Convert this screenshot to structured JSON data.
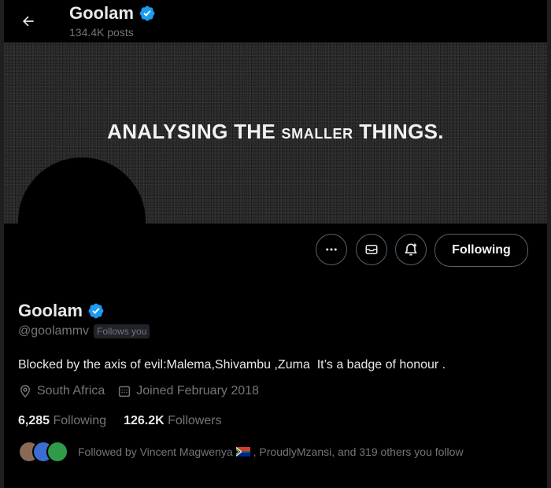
{
  "header": {
    "name": "Goolam",
    "posts_count": "134.4K posts"
  },
  "banner": {
    "text_part1": "ANALYSING THE ",
    "text_small": "SMALLER",
    "text_part2": " THINGS."
  },
  "profile": {
    "name": "Goolam",
    "handle": "@goolammv",
    "follows_you_label": "Follows you",
    "bio": "Blocked by the axis of evil:Malema,Shivambu ,Zuma  It’s a badge of honour .",
    "location": "South Africa",
    "joined": "Joined February 2018"
  },
  "actions": {
    "following_label": "Following"
  },
  "counts": {
    "following_num": "6,285",
    "following_label": " Following",
    "followers_num": "126.2K",
    "followers_label": " Followers"
  },
  "followed_by": {
    "prefix": "Followed by Vincent Magwenya",
    "suffix": ", ProudlyMzansi, and 319 others you follow"
  },
  "icons": {
    "back": "arrow-left-icon",
    "verified": "verified-badge-icon",
    "more": "more-icon",
    "message": "message-icon",
    "notify": "notification-bell-icon",
    "location": "location-icon",
    "calendar": "calendar-icon",
    "flag": "south-africa-flag-icon"
  },
  "colors": {
    "verified_blue": "#1d9bf0",
    "muted_text": "#71767b",
    "primary_text": "#e7e9ea",
    "border": "#536471"
  }
}
